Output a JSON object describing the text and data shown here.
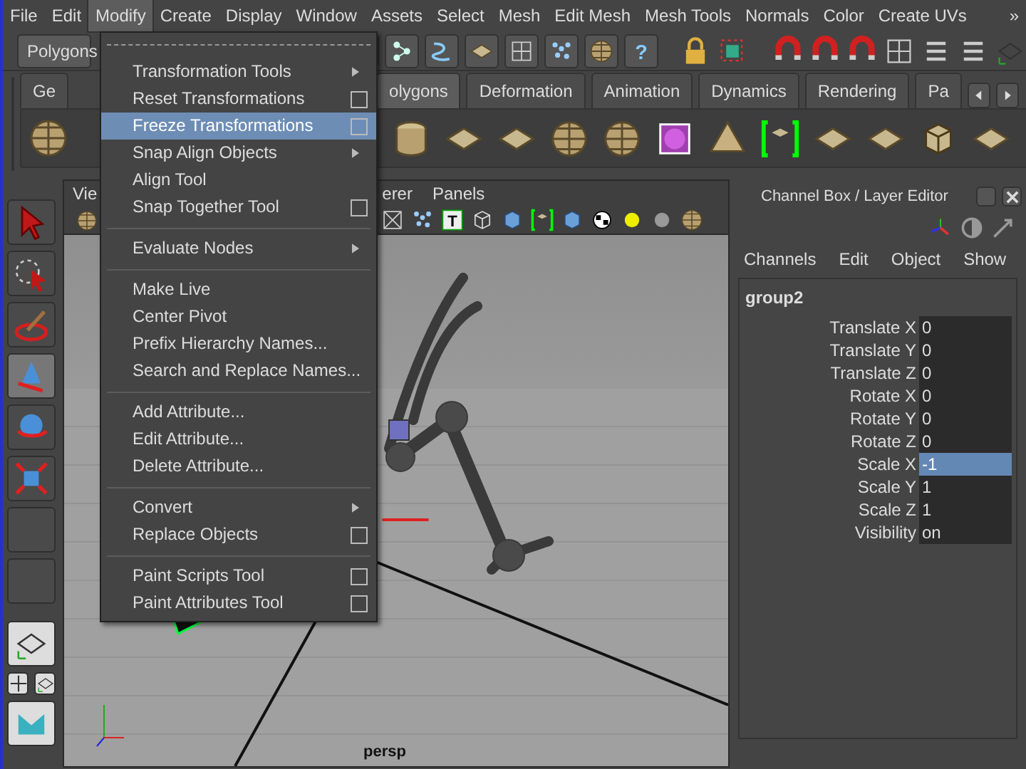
{
  "menubar": [
    {
      "label": "File",
      "selected": false
    },
    {
      "label": "Edit",
      "selected": false
    },
    {
      "label": "Modify",
      "selected": true
    },
    {
      "label": "Create",
      "selected": false
    },
    {
      "label": "Display",
      "selected": false
    },
    {
      "label": "Window",
      "selected": false
    },
    {
      "label": "Assets",
      "selected": false
    },
    {
      "label": "Select",
      "selected": false
    },
    {
      "label": "Mesh",
      "selected": false
    },
    {
      "label": "Edit Mesh",
      "selected": false
    },
    {
      "label": "Mesh Tools",
      "selected": false
    },
    {
      "label": "Normals",
      "selected": false
    },
    {
      "label": "Color",
      "selected": false
    },
    {
      "label": "Create UVs",
      "selected": false
    }
  ],
  "menubar_more": "»",
  "status_line": {
    "mode_dropdown": "Polygons",
    "help_button": "?"
  },
  "shelf": {
    "tabs": [
      {
        "label": "Ge",
        "selected": false
      },
      {
        "label": "olygons",
        "selected": true
      },
      {
        "label": "Deformation",
        "selected": false
      },
      {
        "label": "Animation",
        "selected": false
      },
      {
        "label": "Dynamics",
        "selected": false
      },
      {
        "label": "Rendering",
        "selected": false
      },
      {
        "label": "Pa",
        "selected": false
      }
    ]
  },
  "modify_menu": {
    "items": [
      {
        "kind": "item",
        "label": "Transformation Tools",
        "submenu": true,
        "option_box": false,
        "selected": false
      },
      {
        "kind": "item",
        "label": "Reset Transformations",
        "submenu": false,
        "option_box": true,
        "selected": false
      },
      {
        "kind": "item",
        "label": "Freeze Transformations",
        "submenu": false,
        "option_box": true,
        "selected": true
      },
      {
        "kind": "item",
        "label": "Snap Align Objects",
        "submenu": true,
        "option_box": false,
        "selected": false
      },
      {
        "kind": "item",
        "label": "Align Tool",
        "submenu": false,
        "option_box": false,
        "selected": false
      },
      {
        "kind": "item",
        "label": "Snap Together Tool",
        "submenu": false,
        "option_box": true,
        "selected": false
      },
      {
        "kind": "separator"
      },
      {
        "kind": "item",
        "label": "Evaluate Nodes",
        "submenu": true,
        "option_box": false,
        "selected": false
      },
      {
        "kind": "separator"
      },
      {
        "kind": "item",
        "label": "Make Live",
        "submenu": false,
        "option_box": false,
        "selected": false
      },
      {
        "kind": "item",
        "label": "Center Pivot",
        "submenu": false,
        "option_box": false,
        "selected": false
      },
      {
        "kind": "item",
        "label": "Prefix Hierarchy Names...",
        "submenu": false,
        "option_box": false,
        "selected": false
      },
      {
        "kind": "item",
        "label": "Search and Replace Names...",
        "submenu": false,
        "option_box": false,
        "selected": false
      },
      {
        "kind": "separator"
      },
      {
        "kind": "item",
        "label": "Add Attribute...",
        "submenu": false,
        "option_box": false,
        "selected": false
      },
      {
        "kind": "item",
        "label": "Edit Attribute...",
        "submenu": false,
        "option_box": false,
        "selected": false
      },
      {
        "kind": "item",
        "label": "Delete Attribute...",
        "submenu": false,
        "option_box": false,
        "selected": false
      },
      {
        "kind": "separator"
      },
      {
        "kind": "item",
        "label": "Convert",
        "submenu": true,
        "option_box": false,
        "selected": false
      },
      {
        "kind": "item",
        "label": "Replace Objects",
        "submenu": false,
        "option_box": true,
        "selected": false
      },
      {
        "kind": "separator"
      },
      {
        "kind": "item",
        "label": "Paint Scripts Tool",
        "submenu": false,
        "option_box": true,
        "selected": false
      },
      {
        "kind": "item",
        "label": "Paint Attributes Tool",
        "submenu": false,
        "option_box": true,
        "selected": false
      }
    ]
  },
  "viewport": {
    "panel_menu": [
      "Vie",
      "erer",
      "Panels"
    ],
    "text_toggle": "T",
    "camera_label": "persp"
  },
  "channel_box": {
    "title": "Channel Box / Layer Editor",
    "menu": [
      "Channels",
      "Edit",
      "Object",
      "Show"
    ],
    "object_name": "group2",
    "channels": [
      {
        "label": "Translate X",
        "value": "0",
        "selected": false
      },
      {
        "label": "Translate Y",
        "value": "0",
        "selected": false
      },
      {
        "label": "Translate Z",
        "value": "0",
        "selected": false
      },
      {
        "label": "Rotate X",
        "value": "0",
        "selected": false
      },
      {
        "label": "Rotate Y",
        "value": "0",
        "selected": false
      },
      {
        "label": "Rotate Z",
        "value": "0",
        "selected": false
      },
      {
        "label": "Scale X",
        "value": "-1",
        "selected": true
      },
      {
        "label": "Scale Y",
        "value": "1",
        "selected": false
      },
      {
        "label": "Scale Z",
        "value": "1",
        "selected": false
      },
      {
        "label": "Visibility",
        "value": "on",
        "selected": false
      }
    ]
  }
}
